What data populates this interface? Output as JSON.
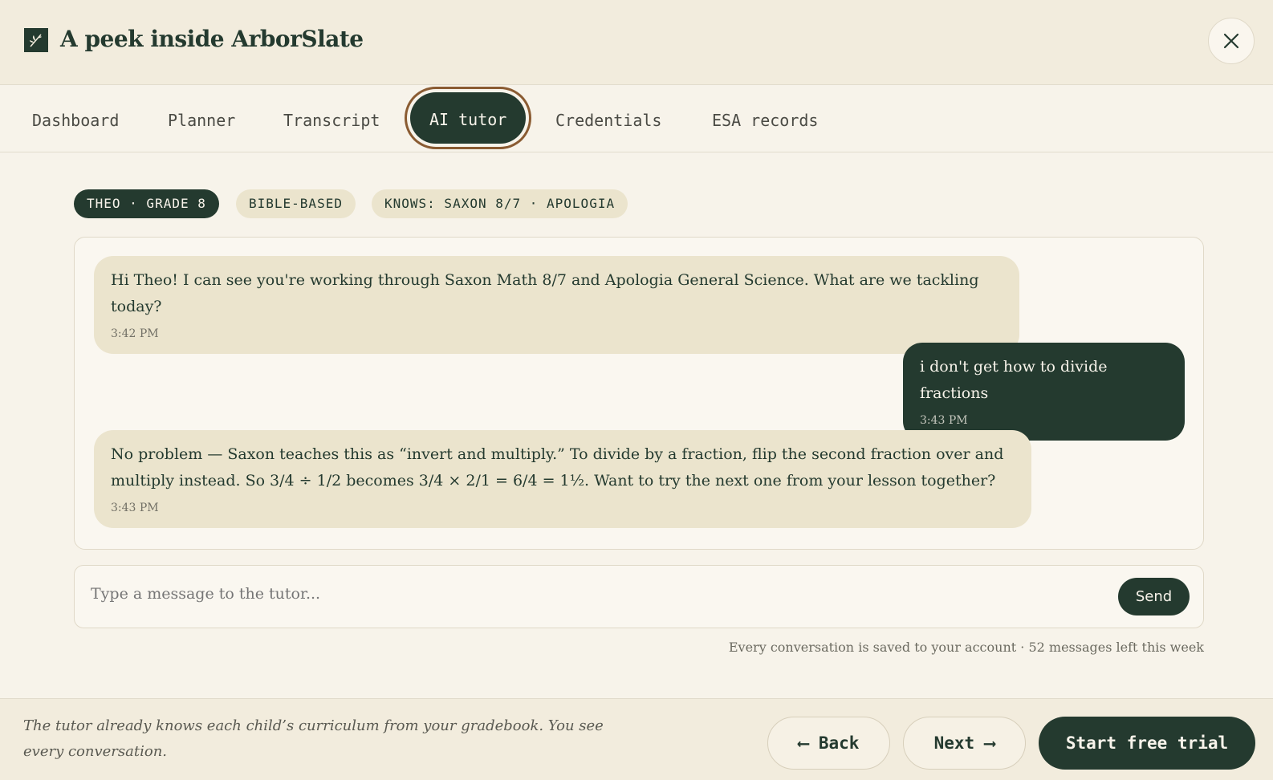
{
  "header": {
    "title": "A peek inside ArborSlate",
    "logo_icon": "leaf-icon",
    "close_icon": "close-icon"
  },
  "tabs": [
    {
      "label": "Dashboard"
    },
    {
      "label": "Planner"
    },
    {
      "label": "Transcript"
    },
    {
      "label": "AI tutor",
      "active": true
    },
    {
      "label": "Credentials"
    },
    {
      "label": "ESA records"
    }
  ],
  "chips": [
    {
      "label": "THEO · GRADE 8"
    },
    {
      "label": "BIBLE-BASED"
    },
    {
      "label": "KNOWS: SAXON 8/7 · APOLOGIA"
    }
  ],
  "messages": [
    {
      "sender": "tutor",
      "text": "Hi Theo! I can see you're working through Saxon Math 8/7 and Apologia General Science. What are we tackling today?",
      "time": "3:42 PM"
    },
    {
      "sender": "student",
      "text": "i don't get how to divide fractions",
      "time": "3:43 PM"
    },
    {
      "sender": "tutor",
      "text_line1": "No problem — Saxon teaches this as “invert and multiply.” To divide by a fraction, flip the second fraction over and",
      "text_line2": "multiply instead. So 3/4 ÷ 1/2 becomes 3/4 × 2/1 = 6/4 = 1½. Want to try the next one from your lesson together?",
      "time": "3:43 PM"
    }
  ],
  "composer": {
    "placeholder": "Type a message to the tutor...",
    "send_label": "Send"
  },
  "meta": "Every conversation is saved to your account · 52 messages left this week",
  "footer": {
    "note": "The tutor already knows each child’s curriculum from your gradebook. You see every conversation.",
    "back_label": "⟵ Back",
    "next_label": "Next ⟶",
    "trial_label": "Start free trial"
  },
  "colors": {
    "primary": "#243a2f",
    "accent_ring": "#8a5b32",
    "bubble": "#ebe4cd",
    "background": "#f7f3ea"
  }
}
